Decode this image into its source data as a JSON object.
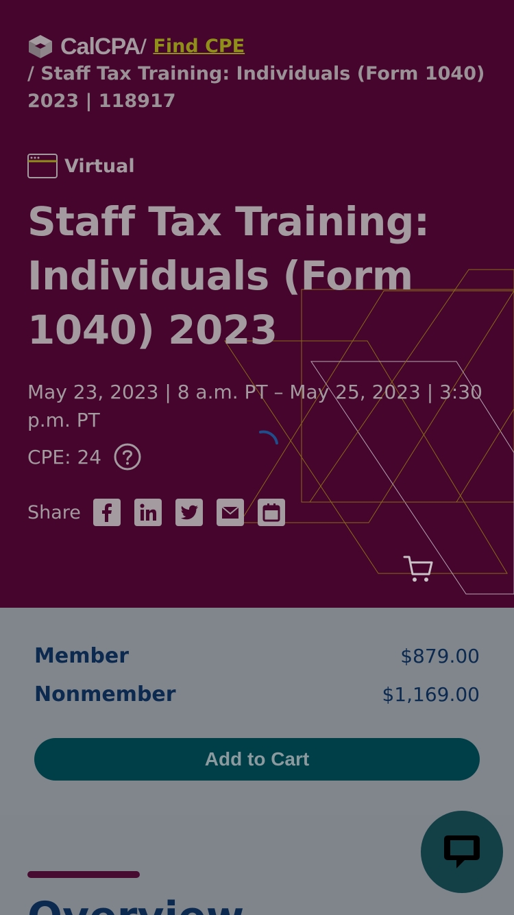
{
  "breadcrumb": {
    "logo_text": "CalCPA",
    "separator": "/",
    "link_label": "Find CPE",
    "current": "/ Staff Tax Training: Individuals (Form 1040) 2023 | 118917"
  },
  "event": {
    "format": "Virtual",
    "title": "Staff Tax Training: Individuals (Form 1040) 2023",
    "dates": "May 23, 2023 | 8 a.m. PT – May 25, 2023 | 3:30 p.m. PT",
    "cpe": "CPE: 24"
  },
  "share": {
    "label": "Share",
    "buttons": [
      "facebook-icon",
      "linkedin-icon",
      "twitter-icon",
      "email-icon",
      "calendar-icon"
    ]
  },
  "pricing": {
    "member_label": "Member",
    "member_price": "$879.00",
    "nonmember_label": "Nonmember",
    "nonmember_price": "$1,169.00",
    "add_to_cart_label": "Add to Cart"
  },
  "overview": {
    "heading": "Overview"
  },
  "colors": {
    "hero_bg": "#45052c",
    "accent_link": "#8f8f1a",
    "pricing_text": "#0c2a4f",
    "button_bg": "#003f47",
    "chat_bg": "#133f46"
  }
}
